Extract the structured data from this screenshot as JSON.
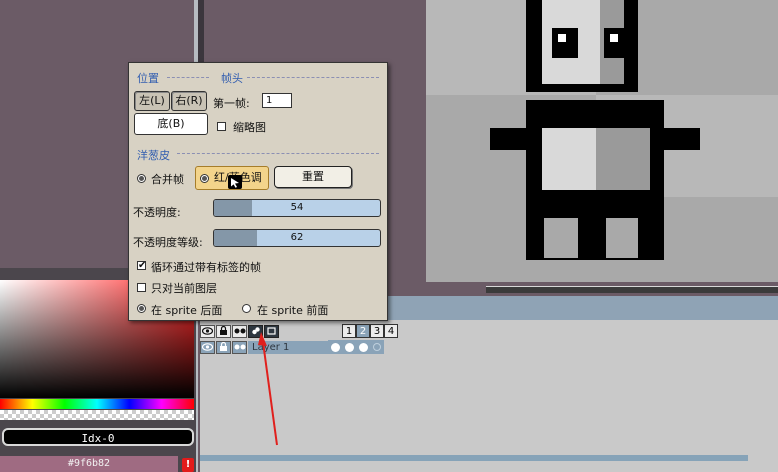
{
  "color_panel": {
    "index_label": "Idx-0",
    "hex_value": "#9f6b82",
    "warning_symbol": "!"
  },
  "timeline": {
    "frames": [
      "1",
      "2",
      "3",
      "4"
    ],
    "selected_frame": "2",
    "layer_name": "Layer 1",
    "header_icons": [
      "eye-icon",
      "lock-icon",
      "continuous-icon",
      "onion-skin-icon",
      "layer-visibility-icon"
    ]
  },
  "onion_popup": {
    "position_section": "位置",
    "frames_section": "帧头",
    "left_button": "左(L)",
    "right_button": "右(R)",
    "bottom_button": "底(B)",
    "first_frame_label": "第一帧:",
    "first_frame_value": "1",
    "thumbnail_label": "缩略图",
    "onion_section": "洋葱皮",
    "merge_frames_label": "合并帧",
    "red_blue_tint_label": "红/蓝色调",
    "reset_button": "重置",
    "opacity_label": "不透明度:",
    "opacity_value": "54",
    "opacity_step_label": "不透明度等级:",
    "opacity_step_value": "62",
    "loop_tagged_label": "循环通过带有标签的帧",
    "current_layer_label": "只对当前图层",
    "behind_sprite_label": "在 sprite 后面",
    "front_sprite_label": "在 sprite 前面"
  },
  "colors": {
    "accent": "#315db0",
    "annotation_arrow": "#e0201d",
    "timeline_selected": "#8aa3b8",
    "popup_bg": "#d8d2c4"
  }
}
